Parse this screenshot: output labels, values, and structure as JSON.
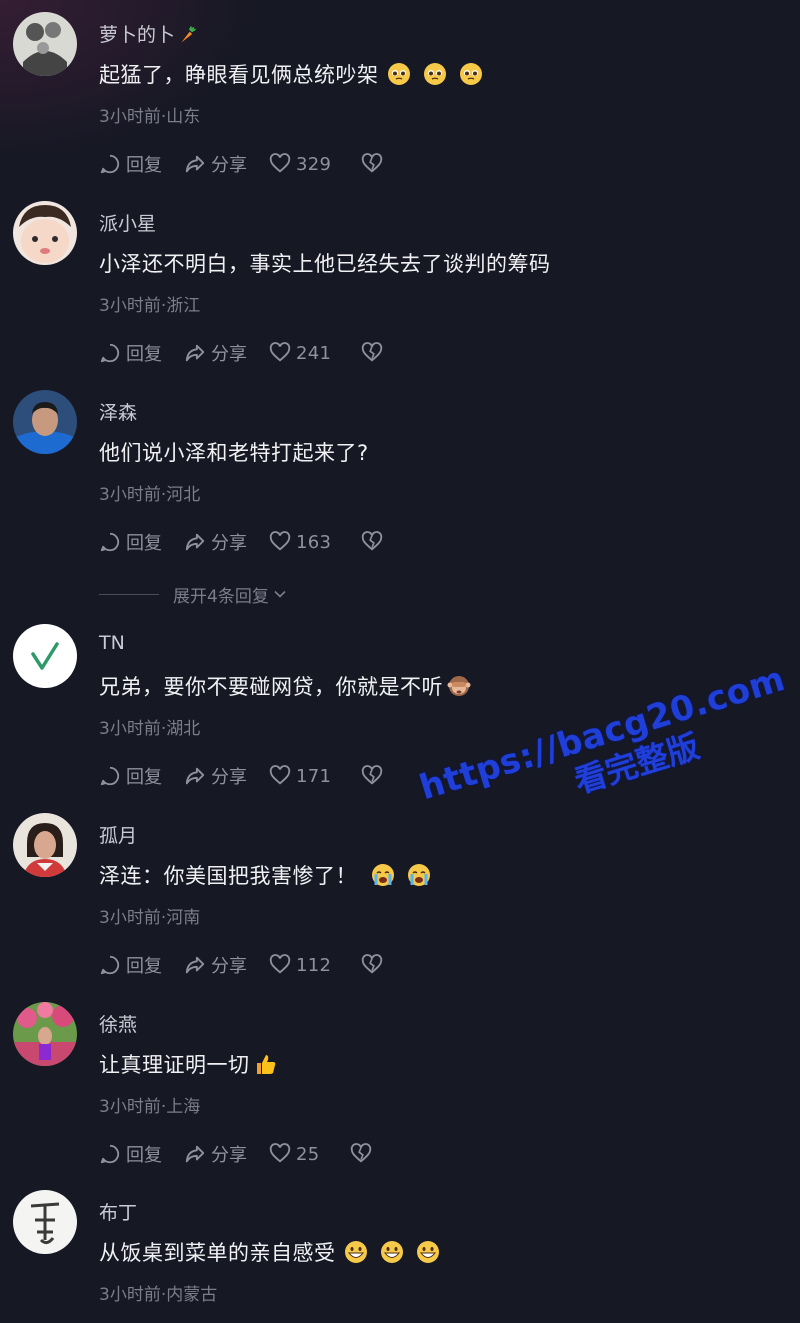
{
  "comments": [
    {
      "username": "萝卜的卜",
      "username_emoji": "carrot-emoji",
      "text": "起猛了，睁眼看见俩总统吵架",
      "text_emojis": [
        "pleading-face-emoji",
        "pleading-face-emoji",
        "pleading-face-emoji"
      ],
      "meta": "3小时前·山东",
      "likes": "329"
    },
    {
      "username": "派小星",
      "text": "小泽还不明白，事实上他已经失去了谈判的筹码",
      "text_emojis": [],
      "meta": "3小时前·浙江",
      "likes": "241"
    },
    {
      "username": "泽森",
      "text": "他们说小泽和老特打起来了?",
      "text_emojis": [],
      "meta": "3小时前·河北",
      "likes": "163"
    },
    {
      "username": "TN",
      "text": "兄弟，要你不要碰网贷，你就是不听",
      "text_emojis": [
        "see-no-evil-monkey-emoji"
      ],
      "meta": "3小时前·湖北",
      "likes": "171"
    },
    {
      "username": "孤月",
      "text": "泽连：你美国把我害惨了！",
      "text_emojis": [
        "crying-face-emoji",
        "crying-face-emoji"
      ],
      "meta": "3小时前·河南",
      "likes": "112"
    },
    {
      "username": "徐燕",
      "text": "让真理证明一切",
      "text_emojis": [
        "thumbs-up-emoji"
      ],
      "meta": "3小时前·上海",
      "likes": "25"
    },
    {
      "username": "布丁",
      "text": "从饭桌到菜单的亲自感受",
      "text_emojis": [
        "grinning-face-emoji",
        "grinning-face-emoji",
        "grinning-face-emoji"
      ],
      "meta": "3小时前·内蒙古"
    }
  ],
  "actions": {
    "reply": "回复",
    "share": "分享"
  },
  "expand_replies": "展开4条回复",
  "watermark": {
    "url": "https://bacg20.com",
    "subtitle": "看完整版"
  },
  "colors": {
    "background": "#161824",
    "watermark": "#1f3fd8"
  }
}
